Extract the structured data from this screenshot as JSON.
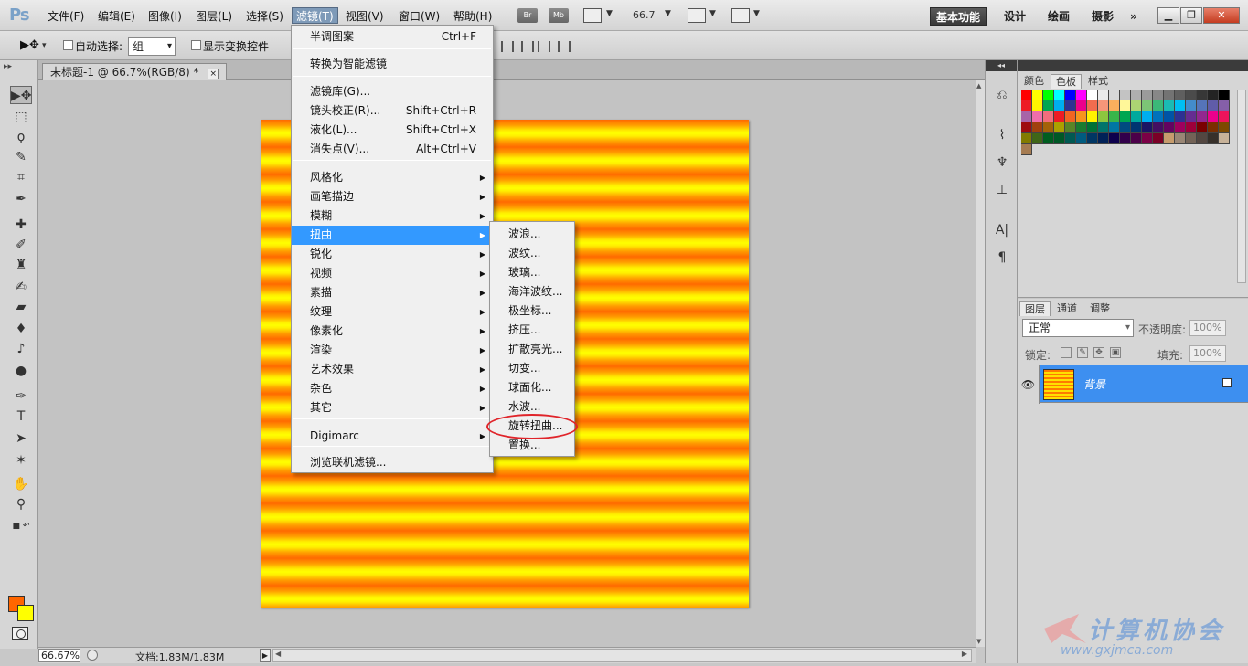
{
  "menubar": {
    "logo": "Ps",
    "items": [
      "文件(F)",
      "编辑(E)",
      "图像(I)",
      "图层(L)",
      "选择(S)",
      "滤镜(T)",
      "视图(V)",
      "窗口(W)",
      "帮助(H)"
    ],
    "bridge": "Br",
    "minibridge": "Mb",
    "zoom": "66.7",
    "workspaces": [
      "基本功能",
      "设计",
      "绘画",
      "摄影"
    ],
    "more": "»"
  },
  "options": {
    "auto_select_label": "自动选择:",
    "auto_select_value": "组",
    "show_transform_label": "显示变换控件"
  },
  "document": {
    "tab_title": "未标题-1 @ 66.7%(RGB/8) *",
    "tab_close": "×"
  },
  "filter_menu": {
    "items": [
      {
        "label": "半调图案",
        "shortcut": "Ctrl+F"
      },
      {
        "label": "转换为智能滤镜"
      },
      {
        "label": "滤镜库(G)..."
      },
      {
        "label": "镜头校正(R)...",
        "shortcut": "Shift+Ctrl+R"
      },
      {
        "label": "液化(L)...",
        "shortcut": "Shift+Ctrl+X"
      },
      {
        "label": "消失点(V)...",
        "shortcut": "Alt+Ctrl+V"
      },
      {
        "label": "风格化"
      },
      {
        "label": "画笔描边"
      },
      {
        "label": "模糊"
      },
      {
        "label": "扭曲"
      },
      {
        "label": "锐化"
      },
      {
        "label": "视频"
      },
      {
        "label": "素描"
      },
      {
        "label": "纹理"
      },
      {
        "label": "像素化"
      },
      {
        "label": "渲染"
      },
      {
        "label": "艺术效果"
      },
      {
        "label": "杂色"
      },
      {
        "label": "其它"
      },
      {
        "label": "Digimarc"
      },
      {
        "label": "浏览联机滤镜..."
      }
    ]
  },
  "distort_submenu": {
    "items": [
      "波浪...",
      "波纹...",
      "玻璃...",
      "海洋波纹...",
      "极坐标...",
      "挤压...",
      "扩散亮光...",
      "切变...",
      "球面化...",
      "水波...",
      "旋转扭曲...",
      "置换..."
    ]
  },
  "status": {
    "zoom": "66.67%",
    "doc_size": "文档:1.83M/1.83M"
  },
  "swatches_panel": {
    "tabs": [
      "颜色",
      "色板",
      "样式"
    ]
  },
  "layers_panel": {
    "tabs": [
      "图层",
      "通道",
      "调整"
    ],
    "blend_mode": "正常",
    "opacity_label": "不透明度:",
    "opacity_value": "100%",
    "lock_label": "锁定:",
    "fill_label": "填充:",
    "fill_value": "100%",
    "layer_name": "背景"
  },
  "watermark": {
    "text": "计算机协会",
    "url": "www.gxjmca.com"
  },
  "colors": {
    "foreground": "#ff6600",
    "background": "#ffff00",
    "menu_highlight": "#3399ff",
    "layer_selected": "#3d8ff0",
    "annotation_circle": "#e0242a"
  },
  "swatch_colors": [
    "#ff0000",
    "#ffff00",
    "#00ff00",
    "#00ffff",
    "#0000ff",
    "#ff00ff",
    "#ffffff",
    "#ebebeb",
    "#d7d7d7",
    "#c3c3c3",
    "#afafaf",
    "#9b9b9b",
    "#878787",
    "#737373",
    "#5f5f5f",
    "#4b4b4b",
    "#373737",
    "#232323",
    "#000000",
    "#ed1c24",
    "#fff200",
    "#00a651",
    "#00aeef",
    "#2e3192",
    "#ec008c",
    "#f26c4f",
    "#f69679",
    "#fbaf5d",
    "#fff799",
    "#acd373",
    "#7cc576",
    "#3bb878",
    "#1abbb4",
    "#00bff3",
    "#438ccb",
    "#5574b9",
    "#605ca8",
    "#855fa8",
    "#a864a8",
    "#f06eaa",
    "#f26d7d",
    "#ed1c24",
    "#f26522",
    "#f7941d",
    "#fff200",
    "#8dc63f",
    "#39b54a",
    "#00a651",
    "#00a99d",
    "#00aeef",
    "#0072bc",
    "#0054a6",
    "#2e3192",
    "#662d91",
    "#92278f",
    "#ec008c",
    "#ed145b",
    "#9e0b0f",
    "#a0410d",
    "#a36209",
    "#aba000",
    "#598527",
    "#1a7b30",
    "#007236",
    "#00746b",
    "#0076a3",
    "#004b80",
    "#003471",
    "#1b1464",
    "#440e62",
    "#630460",
    "#9e005d",
    "#9e0039",
    "#790000",
    "#7b2e00",
    "#7d4900",
    "#827b00",
    "#406618",
    "#005e20",
    "#005826",
    "#005952",
    "#005b7f",
    "#003663",
    "#002157",
    "#0d004c",
    "#32004b",
    "#4b0049",
    "#7b0046",
    "#7a0026",
    "#c69c6d",
    "#998675",
    "#736357",
    "#534741",
    "#37302a",
    "#c7b299",
    "#a67c52"
  ]
}
